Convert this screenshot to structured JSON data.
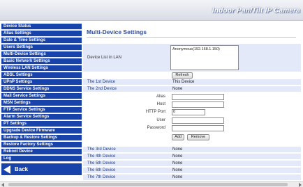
{
  "header": {
    "title": "Indoor Pan/Tilt IP Camera"
  },
  "sidebar": {
    "items": [
      "Device Status",
      "Alias Settings",
      "Date & Time Settings",
      "Users Settings",
      "Multi-Device Settings",
      "Basic Network Settings",
      "Wireless LAN Settings",
      "ADSL Settings",
      "UPnP Settings",
      "DDNS Service Settings",
      "Mail Service Settings",
      "MSN Settings",
      "FTP Service Settings",
      "Alarm Service Settings",
      "PT Settings",
      "Upgrade Device Firmware",
      "Backup & Restore Settings",
      "Restore Factory Settings",
      "Reboot Device",
      "Log"
    ],
    "back_label": "Back"
  },
  "main": {
    "title": "Multi-Device Settings",
    "lan_label": "Device List in LAN",
    "lan_entries": [
      "Anonymous(192.168.1.150)"
    ],
    "refresh_label": "Refresh",
    "first_device": {
      "label": "The 1st Device",
      "value": "This Device"
    },
    "second_device": {
      "label": "The 2nd Device",
      "value": "None"
    },
    "form": {
      "alias_label": "Alias",
      "alias_value": "",
      "host_label": "Host",
      "host_value": "",
      "port_label": "HTTP Port",
      "port_value": "0",
      "user_label": "User",
      "user_value": "",
      "password_label": "Password",
      "password_value": "",
      "add_label": "Add",
      "remove_label": "Remove"
    },
    "other_devices": [
      {
        "label": "The 3rd Device",
        "value": "None"
      },
      {
        "label": "The 4th Device",
        "value": "None"
      },
      {
        "label": "The 5th Device",
        "value": "None"
      },
      {
        "label": "The 6th Device",
        "value": "None"
      },
      {
        "label": "The 7th Device",
        "value": "None"
      }
    ]
  },
  "colors": {
    "nav_bg": "#1843ab",
    "row_shade": "#e3e9f8",
    "title_text": "#2b4a9e"
  }
}
